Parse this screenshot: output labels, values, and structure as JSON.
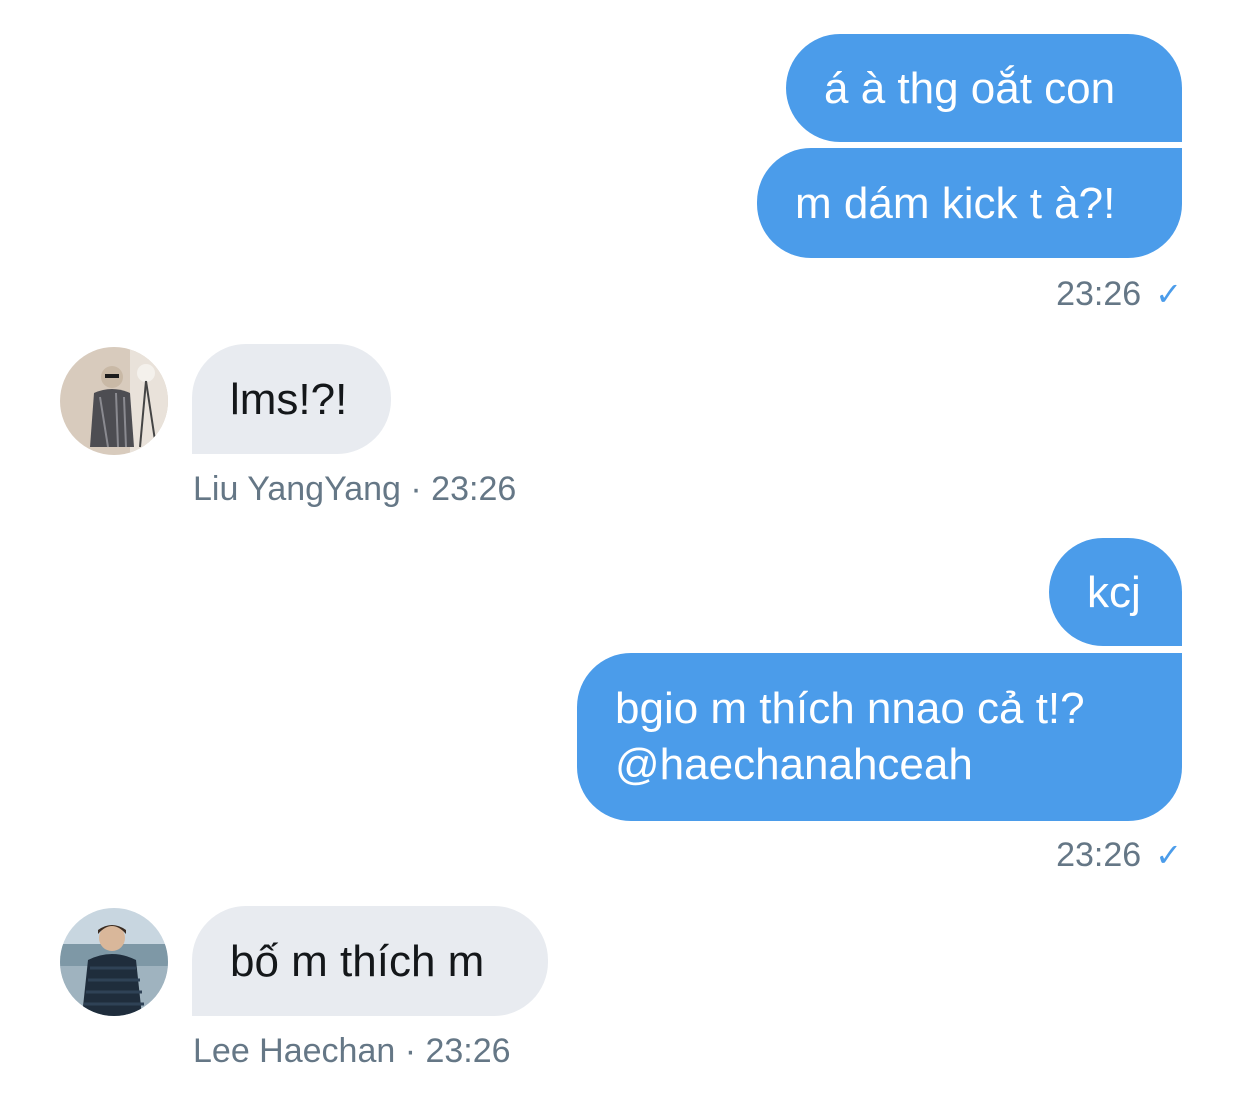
{
  "conversation": {
    "group1": {
      "messages": [
        "á à thg oắt con",
        "m dám kick t à?!"
      ],
      "time": "23:26",
      "check_icon": "check-icon"
    },
    "reply1": {
      "text": "lms!?!",
      "meta": "Liu YangYang · 23:26",
      "avatar_icon": "avatar-liu-yangyang"
    },
    "group2": {
      "messages": [
        "kcj",
        "bgio m thích nnao cả t!?",
        "@haechanahceah"
      ],
      "time": "23:26",
      "check_icon": "check-icon"
    },
    "reply2": {
      "text": "bố m thích m",
      "meta": "Lee Haechan · 23:26",
      "avatar_icon": "avatar-lee-haechan"
    }
  },
  "colors": {
    "sent_bubble": "#4b9cea",
    "received_bubble": "#e8ebf0",
    "meta_text": "#657786",
    "background": "#ffffff"
  }
}
